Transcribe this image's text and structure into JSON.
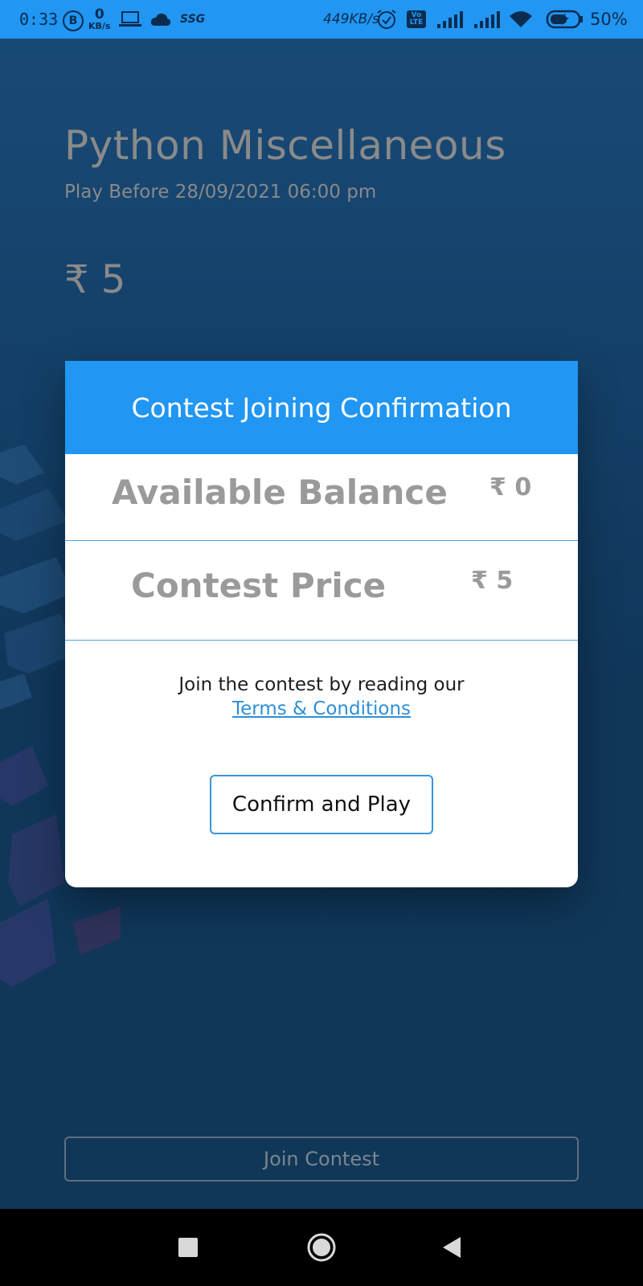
{
  "status_bar": {
    "time": "0:33",
    "bluetooth_badge": "B",
    "net_speed_zero": "0",
    "net_speed_zero_unit": "KB/s",
    "ssg_label": "SSG",
    "net_speed": "449KB/s",
    "volte_top": "Vo",
    "volte_bottom": "LTE",
    "battery_percent": "50%",
    "icons": [
      "laptop-icon",
      "cloud-icon",
      "alarm-icon",
      "signal-icon",
      "wifi-icon",
      "battery-charging-icon"
    ]
  },
  "contest": {
    "title": "Python Miscellaneous",
    "deadline": "Play Before 28/09/2021 06:00 pm",
    "entry_price": "₹ 5"
  },
  "modal": {
    "title": "Contest Joining Confirmation",
    "balance_label": "Available Balance",
    "balance_value": "₹ 0",
    "price_label": "Contest Price",
    "price_value": "₹ 5",
    "terms_text": "Join the contest by reading our",
    "terms_link": "Terms & Conditions",
    "confirm_button": "Confirm and Play"
  },
  "join_button": "Join Contest",
  "nav_bar": {
    "icons": [
      "recents-square-icon",
      "home-circle-icon",
      "back-triangle-icon"
    ]
  },
  "colors": {
    "status_bar": "#2196f3",
    "background": "#11395e",
    "modal_header": "#2196f3",
    "link": "#2d8fd8",
    "button_border": "#3b95d6"
  }
}
